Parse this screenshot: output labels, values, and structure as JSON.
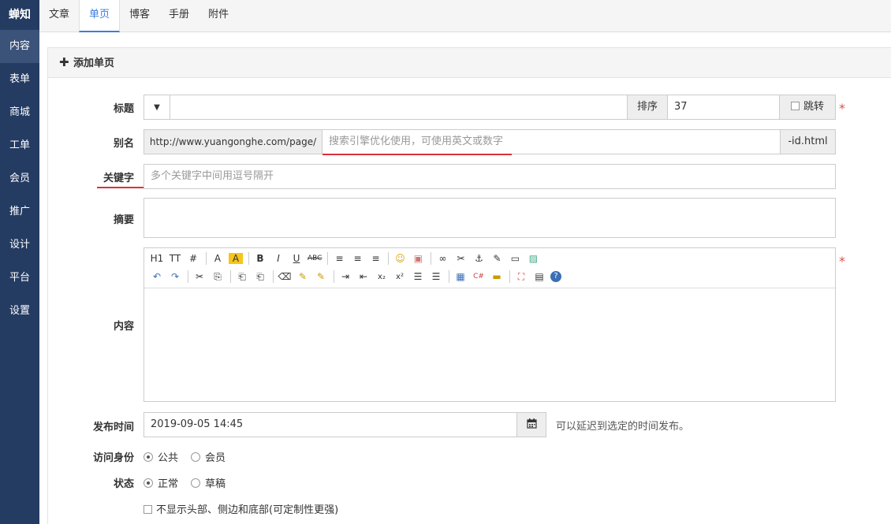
{
  "sidebar": {
    "brand": "蝉知",
    "items": [
      {
        "label": "内容",
        "active": true
      },
      {
        "label": "表单"
      },
      {
        "label": "商城"
      },
      {
        "label": "工单"
      },
      {
        "label": "会员"
      },
      {
        "label": "推广"
      },
      {
        "label": "设计"
      },
      {
        "label": "平台"
      },
      {
        "label": "设置"
      }
    ]
  },
  "topnav": {
    "tabs": [
      "文章",
      "单页",
      "博客",
      "手册",
      "附件"
    ],
    "active": "单页"
  },
  "panel": {
    "title": "添加单页"
  },
  "form": {
    "title": {
      "label": "标题",
      "value": "",
      "order_label": "排序",
      "order_value": "37",
      "jump_label": "跳转",
      "required": "*"
    },
    "alias": {
      "label": "别名",
      "prefix": "http://www.yuangonghe.com/page/",
      "placeholder": "搜索引擎优化使用，可使用英文或数字",
      "suffix": "-id.html"
    },
    "keywords": {
      "label": "关键字",
      "placeholder": "多个关键字中间用逗号隔开"
    },
    "summary": {
      "label": "摘要"
    },
    "content": {
      "label": "内容",
      "required": "*",
      "toolbar_row1": [
        "H1",
        "TT",
        "#",
        "A",
        "A",
        "B",
        "I",
        "U",
        "ABC",
        "≡",
        "≡",
        "≡",
        "☺",
        "▣",
        "∞",
        "✂",
        "⚓",
        "✎",
        "▭",
        "▨"
      ],
      "toolbar_row2": [
        "↶",
        "↷",
        "✂",
        "⎘",
        "⎗",
        "⎗",
        "⌫",
        "✎",
        "✎",
        "⇥",
        "⇤",
        "x₂",
        "x²",
        "☰",
        "☰",
        "▦",
        "C#",
        "▬",
        "⛶",
        "▤",
        "?"
      ]
    },
    "publish": {
      "label": "发布时间",
      "value": "2019-09-05 14:45",
      "hint": "可以延迟到选定的时间发布。"
    },
    "access": {
      "label": "访问身份",
      "options": [
        "公共",
        "会员"
      ],
      "selected": "公共"
    },
    "status": {
      "label": "状态",
      "options": [
        "正常",
        "草稿"
      ],
      "selected": "正常"
    },
    "hide_layout": {
      "label": "不显示头部、侧边和底部(可定制性更强)"
    }
  }
}
